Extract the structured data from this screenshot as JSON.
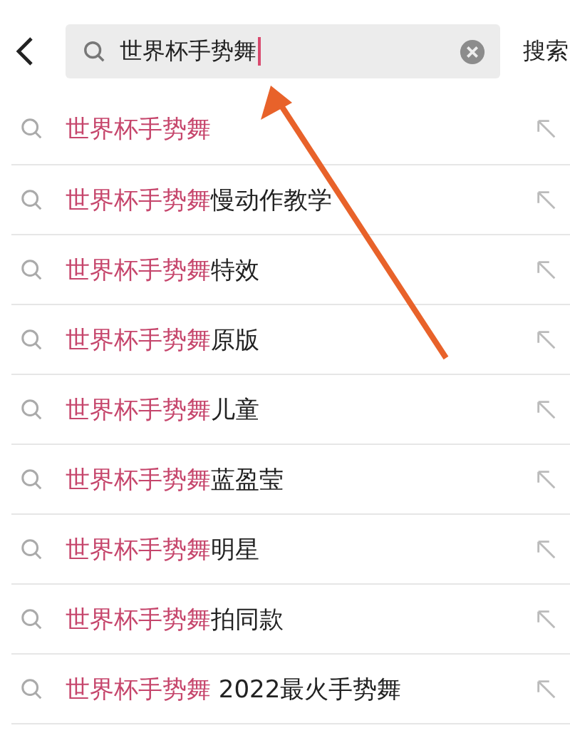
{
  "search": {
    "value": "世界杯手势舞",
    "submit": "搜索"
  },
  "suggestions": [
    {
      "match": "世界杯手势舞"
    },
    {
      "match": "世界杯手势舞",
      "rest": "慢动作教学"
    },
    {
      "match": "世界杯手势舞",
      "rest": "特效"
    },
    {
      "match": "世界杯手势舞",
      "rest": "原版"
    },
    {
      "match": "世界杯手势舞",
      "rest": "儿童"
    },
    {
      "match": "世界杯手势舞",
      "rest": "蓝盈莹"
    },
    {
      "match": "世界杯手势舞",
      "rest": "明星"
    },
    {
      "match": "世界杯手势舞",
      "rest": "拍同款"
    },
    {
      "match": "世界杯手势舞",
      "rest": " 2022最火手势舞"
    }
  ]
}
